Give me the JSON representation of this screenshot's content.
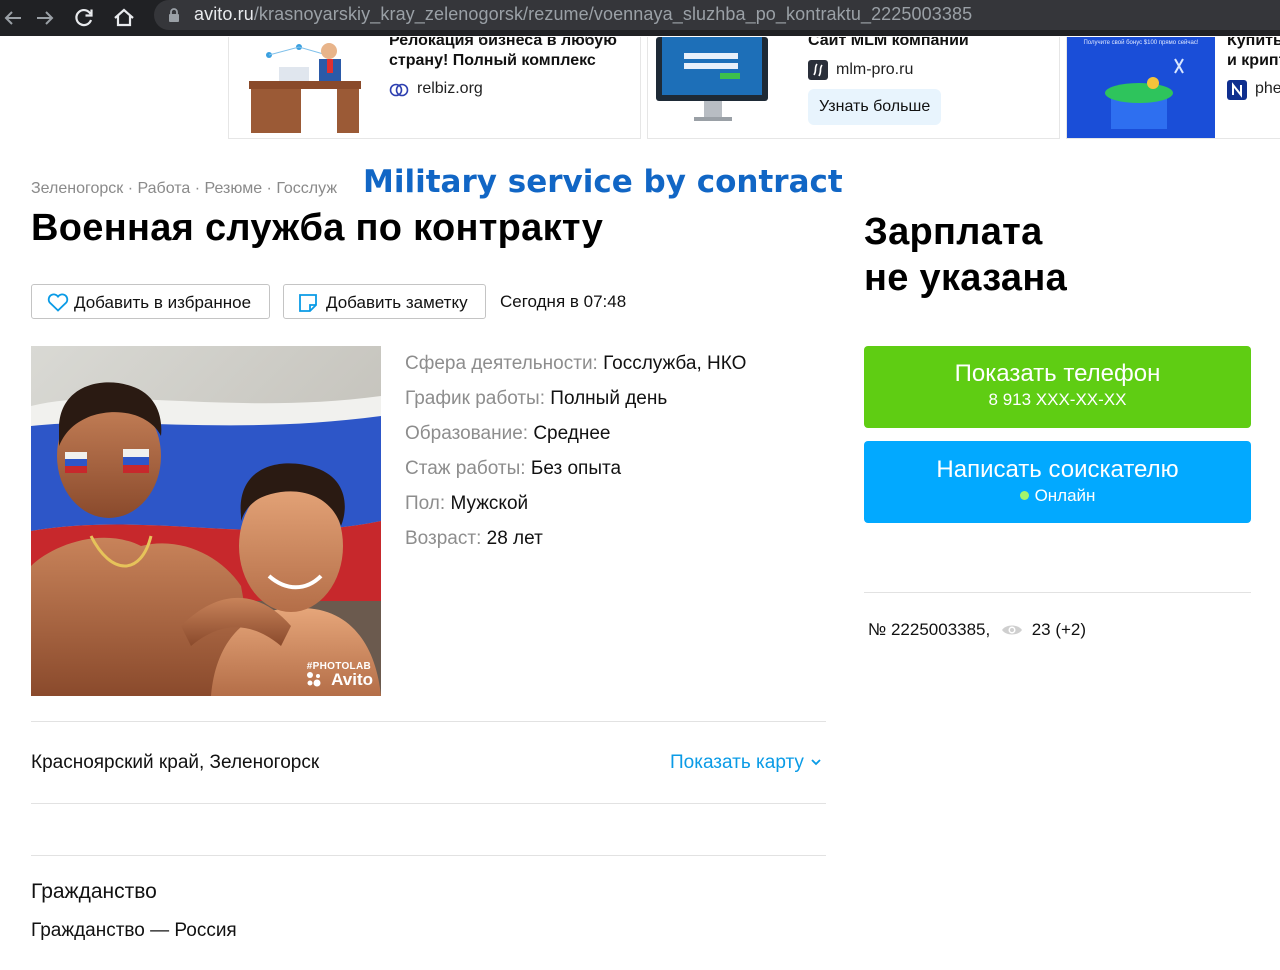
{
  "browser": {
    "url_host": "avito.ru",
    "url_path": "/krasnoyarskiy_kray_zelenogorsk/rezume/voennaya_sluzhba_po_kontraktu_2225003385"
  },
  "ads": [
    {
      "title": "Релокация бизнеса в любую страну! Полный комплекс",
      "domain": "relbiz.org"
    },
    {
      "title": "Сайт MLM компании",
      "domain": "mlm-pro.ru",
      "button": "Узнать больше"
    },
    {
      "title": "Купить и крипт",
      "domain": "phe",
      "banner_text": "Получите свой бонус $100 прямо сейчас!"
    }
  ],
  "breadcrumb": [
    "Зеленогорск",
    "Работа",
    "Резюме",
    "Госслуж"
  ],
  "overlay_caption": "Military service by contract",
  "title": "Военная служба по контракту",
  "actions": {
    "favorite": "Добавить в избранное",
    "note": "Добавить заметку",
    "date": "Сегодня в 07:48"
  },
  "photo": {
    "watermark_line1": "#PHOTOLAB",
    "watermark_line2": "Avito"
  },
  "params": [
    {
      "key": "Сфера деятельности:",
      "value": "Госслужба, НКО"
    },
    {
      "key": "График работы:",
      "value": "Полный день"
    },
    {
      "key": "Образование:",
      "value": "Среднее"
    },
    {
      "key": "Стаж работы:",
      "value": "Без опыта"
    },
    {
      "key": "Пол:",
      "value": "Мужской"
    },
    {
      "key": "Возраст:",
      "value": "28 лет"
    }
  ],
  "location": {
    "address": "Красноярский край, Зеленогорск",
    "show_map": "Показать карту"
  },
  "citizenship": {
    "title": "Гражданство",
    "text": "Гражданство — Россия"
  },
  "salary": {
    "line1": "Зарплата",
    "line2": "не указана"
  },
  "phone_button": {
    "label": "Показать телефон",
    "number": "8 913 XXX-XX-XX"
  },
  "message_button": {
    "label": "Написать соискателю",
    "status": "Онлайн"
  },
  "listing": {
    "number": "№ 2225003385,",
    "views": "23 (+2)"
  },
  "colors": {
    "green": "#5fcd13",
    "blue": "#02a9ff",
    "link": "#0a9be6",
    "overlay": "#1166c5"
  }
}
